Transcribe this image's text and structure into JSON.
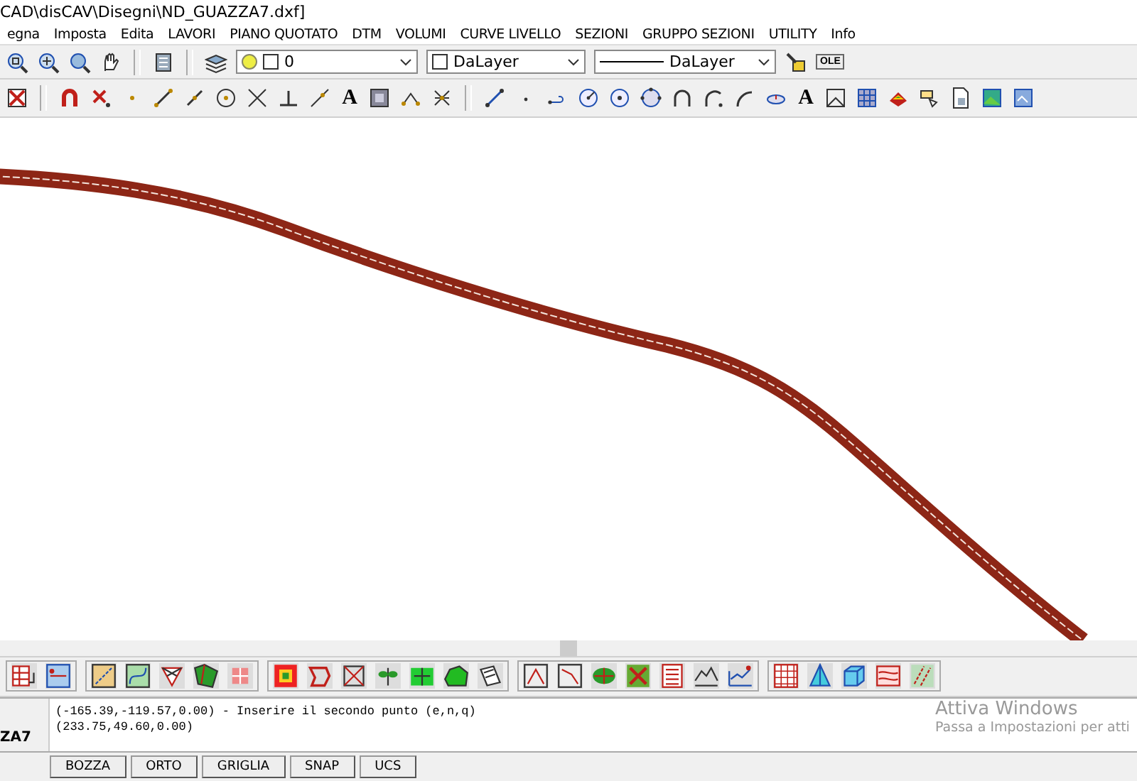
{
  "window": {
    "title": "CAD\\disCAV\\Disegni\\ND_GUAZZA7.dxf]"
  },
  "menu": [
    {
      "label": "egna"
    },
    {
      "label": "Imposta"
    },
    {
      "label": "Edita"
    },
    {
      "label": "LAVORI"
    },
    {
      "label": "PIANO QUOTATO"
    },
    {
      "label": "DTM"
    },
    {
      "label": "VOLUMI"
    },
    {
      "label": "CURVE LIVELLO"
    },
    {
      "label": "SEZIONI"
    },
    {
      "label": "GRUPPO SEZIONI"
    },
    {
      "label": "UTILITY"
    },
    {
      "label": "Info"
    }
  ],
  "layer_toolbar": {
    "layer": "0",
    "color_dropdown": "DaLayer",
    "linetype": "DaLayer",
    "ole_button": "OLE"
  },
  "snap_toolbar": {
    "text_tool": "A"
  },
  "draw_toolbar": {
    "text_tool": "A"
  },
  "drawing_tab": "ZA7",
  "command_lines": [
    "(-165.39,-119.57,0.00) - Inserire il secondo punto (e,n,q)",
    "(233.75,49.60,0.00)"
  ],
  "status_buttons": [
    {
      "label": "BOZZA"
    },
    {
      "label": "ORTO"
    },
    {
      "label": "GRIGLIA"
    },
    {
      "label": "SNAP"
    },
    {
      "label": "UCS"
    }
  ],
  "activation_notice": {
    "title": "Attiva Windows",
    "subtitle": "Passa a Impostazioni per atti"
  }
}
